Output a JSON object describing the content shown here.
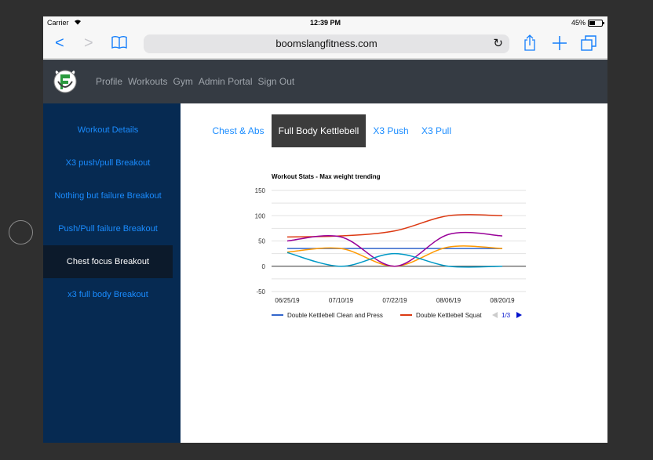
{
  "status_bar": {
    "carrier": "Carrier",
    "time": "12:39 PM",
    "battery": "45%"
  },
  "browser": {
    "url": "boomslangfitness.com",
    "back_icon": "<",
    "forward_icon": ">"
  },
  "site_nav": [
    "Profile",
    "Workouts",
    "Gym",
    "Admin Portal",
    "Sign Out"
  ],
  "sidebar": {
    "items": [
      {
        "label": "Workout Details"
      },
      {
        "label": "X3 push/pull Breakout"
      },
      {
        "label": "Nothing but failure Breakout"
      },
      {
        "label": "Push/Pull failure Breakout"
      },
      {
        "label": "Chest focus Breakout",
        "active": true
      },
      {
        "label": "x3 full body Breakout"
      }
    ]
  },
  "tabs": [
    {
      "label": "Chest & Abs"
    },
    {
      "label": "Full Body Kettlebell",
      "active": true
    },
    {
      "label": "X3 Push"
    },
    {
      "label": "X3 Pull"
    }
  ],
  "chart_data": {
    "type": "line",
    "title": "Workout Stats - Max weight trending",
    "categories": [
      "06/25/19",
      "07/10/19",
      "07/22/19",
      "08/06/19",
      "08/20/19"
    ],
    "yticks": [
      150,
      100,
      50,
      0,
      -50
    ],
    "ylim": [
      -50,
      150
    ],
    "series": [
      {
        "name": "Double Kettlebell Clean and Press",
        "color": "#3366cc",
        "values": [
          35,
          35,
          35,
          35,
          35
        ]
      },
      {
        "name": "Double Kettlebell Squat",
        "color": "#dc3912",
        "values": [
          58,
          60,
          70,
          100,
          100
        ]
      },
      {
        "color": "#ff9900",
        "values": [
          28,
          35,
          0,
          38,
          35
        ]
      },
      {
        "color": "#990099",
        "values": [
          50,
          58,
          0,
          63,
          60
        ]
      },
      {
        "color": "#0099c6",
        "values": [
          27,
          0,
          25,
          0,
          0
        ]
      }
    ],
    "legend_pager": "1/3",
    "grid": true
  }
}
